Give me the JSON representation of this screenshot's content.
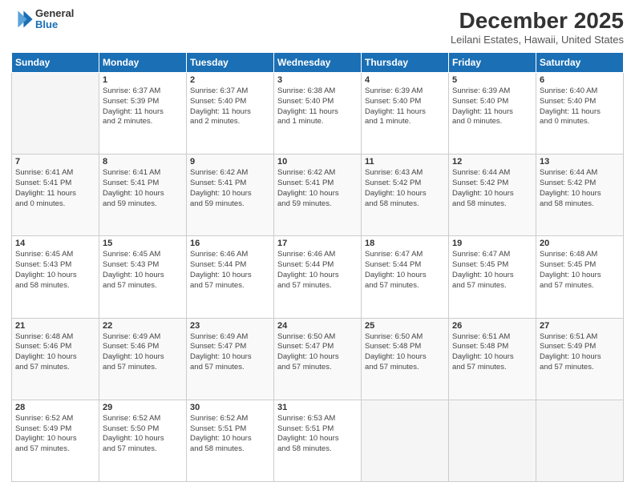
{
  "logo": {
    "general": "General",
    "blue": "Blue",
    "icon": "▶"
  },
  "header": {
    "month_year": "December 2025",
    "location": "Leilani Estates, Hawaii, United States"
  },
  "days_of_week": [
    "Sunday",
    "Monday",
    "Tuesday",
    "Wednesday",
    "Thursday",
    "Friday",
    "Saturday"
  ],
  "weeks": [
    [
      {
        "day": "",
        "content": ""
      },
      {
        "day": "1",
        "content": "Sunrise: 6:37 AM\nSunset: 5:39 PM\nDaylight: 11 hours\nand 2 minutes."
      },
      {
        "day": "2",
        "content": "Sunrise: 6:37 AM\nSunset: 5:40 PM\nDaylight: 11 hours\nand 2 minutes."
      },
      {
        "day": "3",
        "content": "Sunrise: 6:38 AM\nSunset: 5:40 PM\nDaylight: 11 hours\nand 1 minute."
      },
      {
        "day": "4",
        "content": "Sunrise: 6:39 AM\nSunset: 5:40 PM\nDaylight: 11 hours\nand 1 minute."
      },
      {
        "day": "5",
        "content": "Sunrise: 6:39 AM\nSunset: 5:40 PM\nDaylight: 11 hours\nand 0 minutes."
      },
      {
        "day": "6",
        "content": "Sunrise: 6:40 AM\nSunset: 5:40 PM\nDaylight: 11 hours\nand 0 minutes."
      }
    ],
    [
      {
        "day": "7",
        "content": "Sunrise: 6:41 AM\nSunset: 5:41 PM\nDaylight: 11 hours\nand 0 minutes."
      },
      {
        "day": "8",
        "content": "Sunrise: 6:41 AM\nSunset: 5:41 PM\nDaylight: 10 hours\nand 59 minutes."
      },
      {
        "day": "9",
        "content": "Sunrise: 6:42 AM\nSunset: 5:41 PM\nDaylight: 10 hours\nand 59 minutes."
      },
      {
        "day": "10",
        "content": "Sunrise: 6:42 AM\nSunset: 5:41 PM\nDaylight: 10 hours\nand 59 minutes."
      },
      {
        "day": "11",
        "content": "Sunrise: 6:43 AM\nSunset: 5:42 PM\nDaylight: 10 hours\nand 58 minutes."
      },
      {
        "day": "12",
        "content": "Sunrise: 6:44 AM\nSunset: 5:42 PM\nDaylight: 10 hours\nand 58 minutes."
      },
      {
        "day": "13",
        "content": "Sunrise: 6:44 AM\nSunset: 5:42 PM\nDaylight: 10 hours\nand 58 minutes."
      }
    ],
    [
      {
        "day": "14",
        "content": "Sunrise: 6:45 AM\nSunset: 5:43 PM\nDaylight: 10 hours\nand 58 minutes."
      },
      {
        "day": "15",
        "content": "Sunrise: 6:45 AM\nSunset: 5:43 PM\nDaylight: 10 hours\nand 57 minutes."
      },
      {
        "day": "16",
        "content": "Sunrise: 6:46 AM\nSunset: 5:44 PM\nDaylight: 10 hours\nand 57 minutes."
      },
      {
        "day": "17",
        "content": "Sunrise: 6:46 AM\nSunset: 5:44 PM\nDaylight: 10 hours\nand 57 minutes."
      },
      {
        "day": "18",
        "content": "Sunrise: 6:47 AM\nSunset: 5:44 PM\nDaylight: 10 hours\nand 57 minutes."
      },
      {
        "day": "19",
        "content": "Sunrise: 6:47 AM\nSunset: 5:45 PM\nDaylight: 10 hours\nand 57 minutes."
      },
      {
        "day": "20",
        "content": "Sunrise: 6:48 AM\nSunset: 5:45 PM\nDaylight: 10 hours\nand 57 minutes."
      }
    ],
    [
      {
        "day": "21",
        "content": "Sunrise: 6:48 AM\nSunset: 5:46 PM\nDaylight: 10 hours\nand 57 minutes."
      },
      {
        "day": "22",
        "content": "Sunrise: 6:49 AM\nSunset: 5:46 PM\nDaylight: 10 hours\nand 57 minutes."
      },
      {
        "day": "23",
        "content": "Sunrise: 6:49 AM\nSunset: 5:47 PM\nDaylight: 10 hours\nand 57 minutes."
      },
      {
        "day": "24",
        "content": "Sunrise: 6:50 AM\nSunset: 5:47 PM\nDaylight: 10 hours\nand 57 minutes."
      },
      {
        "day": "25",
        "content": "Sunrise: 6:50 AM\nSunset: 5:48 PM\nDaylight: 10 hours\nand 57 minutes."
      },
      {
        "day": "26",
        "content": "Sunrise: 6:51 AM\nSunset: 5:48 PM\nDaylight: 10 hours\nand 57 minutes."
      },
      {
        "day": "27",
        "content": "Sunrise: 6:51 AM\nSunset: 5:49 PM\nDaylight: 10 hours\nand 57 minutes."
      }
    ],
    [
      {
        "day": "28",
        "content": "Sunrise: 6:52 AM\nSunset: 5:49 PM\nDaylight: 10 hours\nand 57 minutes."
      },
      {
        "day": "29",
        "content": "Sunrise: 6:52 AM\nSunset: 5:50 PM\nDaylight: 10 hours\nand 57 minutes."
      },
      {
        "day": "30",
        "content": "Sunrise: 6:52 AM\nSunset: 5:51 PM\nDaylight: 10 hours\nand 58 minutes."
      },
      {
        "day": "31",
        "content": "Sunrise: 6:53 AM\nSunset: 5:51 PM\nDaylight: 10 hours\nand 58 minutes."
      },
      {
        "day": "",
        "content": ""
      },
      {
        "day": "",
        "content": ""
      },
      {
        "day": "",
        "content": ""
      }
    ]
  ]
}
